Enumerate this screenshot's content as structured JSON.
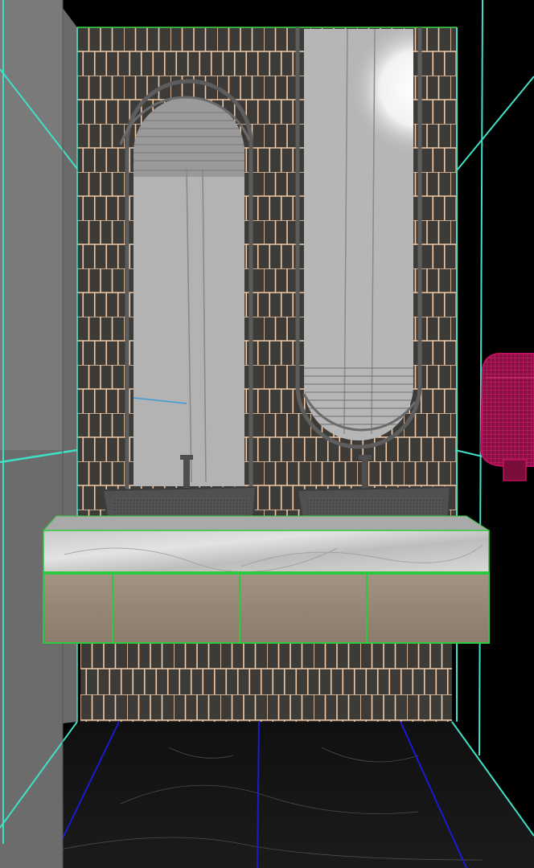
{
  "viewport": {
    "wireframe_colors": {
      "room_edges": "#3fe0c6",
      "tile_grout": "#f3c9a6",
      "tile_fill": "#3d3b38",
      "vanity_edges": "#2fc83a",
      "floor_lines": "#1a1ad0",
      "dryer": "#c01060"
    }
  }
}
